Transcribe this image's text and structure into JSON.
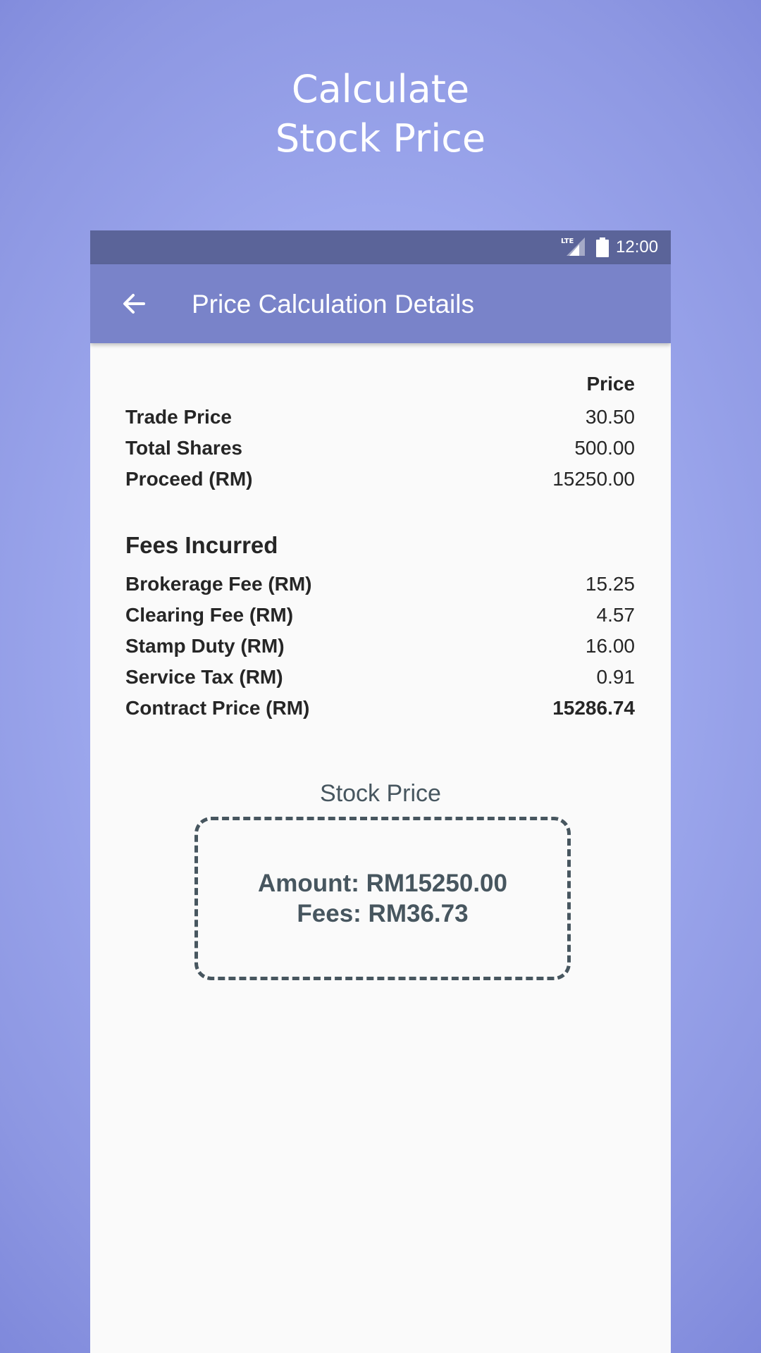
{
  "promo": {
    "title_line1": "Calculate",
    "title_line2": "Stock Price"
  },
  "status_bar": {
    "network": "LTE",
    "time": "12:00"
  },
  "app_bar": {
    "title": "Price Calculation Details",
    "back_icon": "arrow-back-icon"
  },
  "details": {
    "column_header": "Price",
    "rows": [
      {
        "label": "Trade Price",
        "value": "30.50"
      },
      {
        "label": "Total Shares",
        "value": "500.00"
      },
      {
        "label": "Proceed (RM)",
        "value": "15250.00"
      }
    ]
  },
  "fees": {
    "title": "Fees Incurred",
    "rows": [
      {
        "label": "Brokerage Fee (RM)",
        "value": "15.25"
      },
      {
        "label": "Clearing Fee (RM)",
        "value": "4.57"
      },
      {
        "label": "Stamp Duty (RM)",
        "value": "16.00"
      },
      {
        "label": "Service Tax (RM)",
        "value": "0.91"
      },
      {
        "label": "Contract Price (RM)",
        "value": "15286.74"
      }
    ]
  },
  "summary": {
    "title": "Stock Price",
    "amount": "Amount: RM15250.00",
    "fees": "Fees: RM36.73"
  },
  "colors": {
    "status_bar": "#5b6499",
    "app_bar": "#7983c9",
    "summary_text": "#47565f"
  }
}
